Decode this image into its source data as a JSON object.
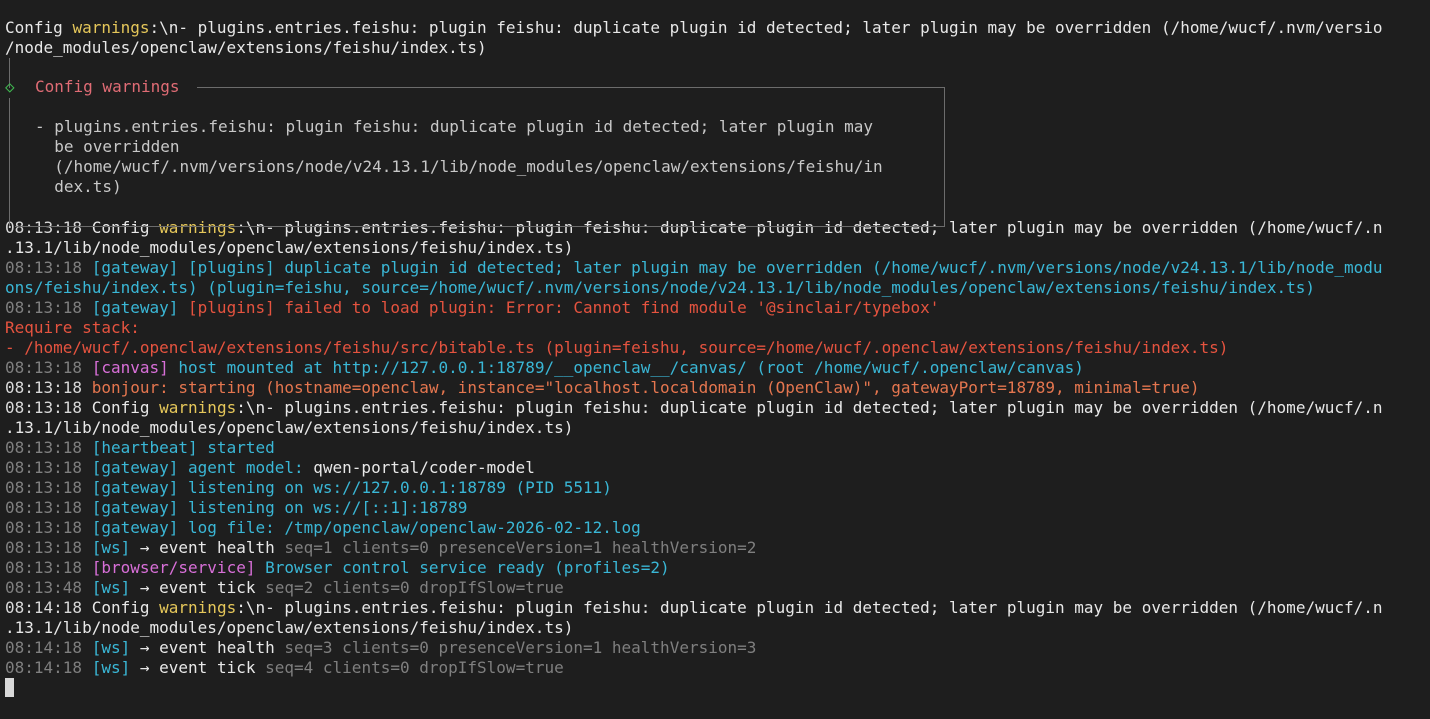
{
  "log": {
    "lines_before_box": [
      [
        {
          "t": "Config ",
          "c": "white"
        },
        {
          "t": "warnings",
          "c": "yel"
        },
        {
          "t": ":\\n- plugins.entries.feishu: plugin feishu: duplicate plugin id detected; later plugin may be overridden (/home/wucf/.nvm/versio",
          "c": "white"
        }
      ],
      [
        {
          "t": "/node_modules/openclaw/extensions/feishu/index.ts)",
          "c": "white"
        }
      ]
    ],
    "box": {
      "title": "Config warnings",
      "diamond": "◇",
      "body": [
        "- plugins.entries.feishu: plugin feishu: duplicate plugin id detected; later plugin may",
        "  be overridden",
        "  (/home/wucf/.nvm/versions/node/v24.13.1/lib/node_modules/openclaw/extensions/feishu/in",
        "  dex.ts)"
      ]
    },
    "lines_after_box": [
      [
        {
          "t": "08:13:18 ",
          "c": "ts-w"
        },
        {
          "t": "Config ",
          "c": "white"
        },
        {
          "t": "warnings",
          "c": "yel"
        },
        {
          "t": ":\\n- plugins.entries.feishu: plugin feishu: duplicate plugin id detected; later plugin may be overridden (/home/wucf/.n",
          "c": "white"
        }
      ],
      [
        {
          "t": ".13.1/lib/node_modules/openclaw/extensions/feishu/index.ts)",
          "c": "white"
        }
      ],
      [
        {
          "t": "08:13:18 ",
          "c": "ts"
        },
        {
          "t": "[gateway] [plugins] duplicate plugin id detected; later plugin may be overridden (/home/wucf/.nvm/versions/node/v24.13.1/lib/node_modu",
          "c": "cyan"
        }
      ],
      [
        {
          "t": "ons/feishu/index.ts) (plugin=feishu, source=/home/wucf/.nvm/versions/node/v24.13.1/lib/node_modules/openclaw/extensions/feishu/index.ts)",
          "c": "cyan"
        }
      ],
      [
        {
          "t": "08:13:18 ",
          "c": "ts"
        },
        {
          "t": "[gateway] ",
          "c": "cyan"
        },
        {
          "t": "[plugins] failed to load plugin: Error: Cannot find module '@sinclair/typebox'",
          "c": "red"
        }
      ],
      [
        {
          "t": "Require stack:",
          "c": "red"
        }
      ],
      [
        {
          "t": "- /home/wucf/.openclaw/extensions/feishu/src/bitable.ts (plugin=feishu, source=/home/wucf/.openclaw/extensions/feishu/index.ts)",
          "c": "red"
        }
      ],
      [
        {
          "t": "08:13:18 ",
          "c": "ts"
        },
        {
          "t": "[canvas] ",
          "c": "magenta"
        },
        {
          "t": "host mounted at http://127.0.0.1:18789/__openclaw__/canvas/ (root /home/wucf/.openclaw/canvas)",
          "c": "cyan"
        }
      ],
      [
        {
          "t": "08:13:18 ",
          "c": "ts-w"
        },
        {
          "t": "bonjour: starting (hostname=openclaw, instance=\"localhost.localdomain (OpenClaw)\", gatewayPort=18789, minimal=true)",
          "c": "orange"
        }
      ],
      [
        {
          "t": "08:13:18 ",
          "c": "ts-w"
        },
        {
          "t": "Config ",
          "c": "white"
        },
        {
          "t": "warnings",
          "c": "yel"
        },
        {
          "t": ":\\n- plugins.entries.feishu: plugin feishu: duplicate plugin id detected; later plugin may be overridden (/home/wucf/.n",
          "c": "white"
        }
      ],
      [
        {
          "t": ".13.1/lib/node_modules/openclaw/extensions/feishu/index.ts)",
          "c": "white"
        }
      ],
      [
        {
          "t": "08:13:18 ",
          "c": "ts"
        },
        {
          "t": "[heartbeat] started",
          "c": "cyan"
        }
      ],
      [
        {
          "t": "08:13:18 ",
          "c": "ts"
        },
        {
          "t": "[gateway] agent model: ",
          "c": "cyan"
        },
        {
          "t": "qwen-portal/coder-model",
          "c": "white"
        }
      ],
      [
        {
          "t": "08:13:18 ",
          "c": "ts"
        },
        {
          "t": "[gateway] listening on ws://127.0.0.1:18789 (PID 5511)",
          "c": "cyan"
        }
      ],
      [
        {
          "t": "08:13:18 ",
          "c": "ts"
        },
        {
          "t": "[gateway] listening on ws://[::1]:18789",
          "c": "cyan"
        }
      ],
      [
        {
          "t": "08:13:18 ",
          "c": "ts"
        },
        {
          "t": "[gateway] log file: /tmp/openclaw/openclaw-2026-02-12.log",
          "c": "cyan"
        }
      ],
      [
        {
          "t": "08:13:18 ",
          "c": "ts"
        },
        {
          "t": "[ws] ",
          "c": "cyan"
        },
        {
          "t": "→ event health ",
          "c": "white"
        },
        {
          "t": "seq=1 clients=0 presenceVersion=1 healthVersion=2",
          "c": "dim"
        }
      ],
      [
        {
          "t": "08:13:18 ",
          "c": "ts"
        },
        {
          "t": "[browser/service] ",
          "c": "magenta"
        },
        {
          "t": "Browser control service ready (profiles=2)",
          "c": "cyan"
        }
      ],
      [
        {
          "t": "08:13:48 ",
          "c": "ts"
        },
        {
          "t": "[ws] ",
          "c": "cyan"
        },
        {
          "t": "→ event tick ",
          "c": "white"
        },
        {
          "t": "seq=2 clients=0 dropIfSlow=true",
          "c": "dim"
        }
      ],
      [
        {
          "t": "08:14:18 ",
          "c": "ts-w"
        },
        {
          "t": "Config ",
          "c": "white"
        },
        {
          "t": "warnings",
          "c": "yel"
        },
        {
          "t": ":\\n- plugins.entries.feishu: plugin feishu: duplicate plugin id detected; later plugin may be overridden (/home/wucf/.n",
          "c": "white"
        }
      ],
      [
        {
          "t": ".13.1/lib/node_modules/openclaw/extensions/feishu/index.ts)",
          "c": "white"
        }
      ],
      [
        {
          "t": "08:14:18 ",
          "c": "ts"
        },
        {
          "t": "[ws] ",
          "c": "cyan"
        },
        {
          "t": "→ event health ",
          "c": "white"
        },
        {
          "t": "seq=3 clients=0 presenceVersion=1 healthVersion=3",
          "c": "dim"
        }
      ],
      [
        {
          "t": "08:14:18 ",
          "c": "ts"
        },
        {
          "t": "[ws] ",
          "c": "cyan"
        },
        {
          "t": "→ event tick ",
          "c": "white"
        },
        {
          "t": "seq=4 clients=0 dropIfSlow=true",
          "c": "dim"
        }
      ]
    ]
  },
  "colors": {
    "background": "#1e1e1e",
    "timestamp": "#7f7f7f",
    "warning": "#e5c75a",
    "info": "#3ab7d6",
    "error": "#e5533f",
    "subsystem_magenta": "#d86fd8",
    "box_title": "#e06c75",
    "diamond": "#3fb950"
  }
}
